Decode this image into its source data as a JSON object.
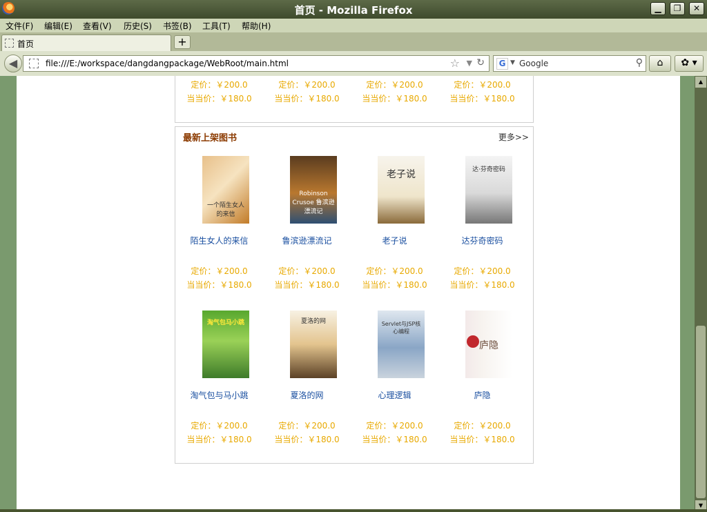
{
  "window": {
    "title": "首页 - Mozilla Firefox"
  },
  "menu": [
    "文件(F)",
    "编辑(E)",
    "查看(V)",
    "历史(S)",
    "书签(B)",
    "工具(T)",
    "帮助(H)"
  ],
  "tab": {
    "label": "首页",
    "new_tab": "+"
  },
  "nav": {
    "url": "file:///E:/workspace/dangdangpackage/WebRoot/main.html",
    "search_placeholder": "Google",
    "search_engine": "G"
  },
  "section_top": {
    "prices": [
      {
        "list": "定价：￥200.0",
        "sale": "当当价：￥180.0"
      },
      {
        "list": "定价：￥200.0",
        "sale": "当当价：￥180.0"
      },
      {
        "list": "定价：￥200.0",
        "sale": "当当价：￥180.0"
      },
      {
        "list": "定价：￥200.0",
        "sale": "当当价：￥180.0"
      }
    ]
  },
  "section_new": {
    "title": "最新上架图书",
    "more": "更多>>",
    "books": [
      {
        "name": "陌生女人的来信",
        "list": "定价：￥200.0",
        "sale": "当当价：￥180.0",
        "cover_text": "一个陌生女人的来信"
      },
      {
        "name": "鲁滨逊漂流记",
        "list": "定价：￥200.0",
        "sale": "当当价：￥180.0",
        "cover_text": "Robinson Crusoe 鲁滨逊漂流记"
      },
      {
        "name": "老子说",
        "list": "定价：￥200.0",
        "sale": "当当价：￥180.0",
        "cover_text": "老子说"
      },
      {
        "name": "达芬奇密码",
        "list": "定价：￥200.0",
        "sale": "当当价：￥180.0",
        "cover_text": "达·芬奇密码"
      },
      {
        "name": "淘气包与马小跳",
        "list": "定价：￥200.0",
        "sale": "当当价：￥180.0",
        "cover_text": "淘气包马小跳"
      },
      {
        "name": "夏洛的网",
        "list": "定价：￥200.0",
        "sale": "当当价：￥180.0",
        "cover_text": "夏洛的网"
      },
      {
        "name": "心理逻辑",
        "list": "定价：￥200.0",
        "sale": "当当价：￥180.0",
        "cover_text": "Servlet与JSP核心编程"
      },
      {
        "name": "庐隐",
        "list": "定价：￥200.0",
        "sale": "当当价：￥180.0",
        "cover_text": "庐隐"
      }
    ]
  }
}
